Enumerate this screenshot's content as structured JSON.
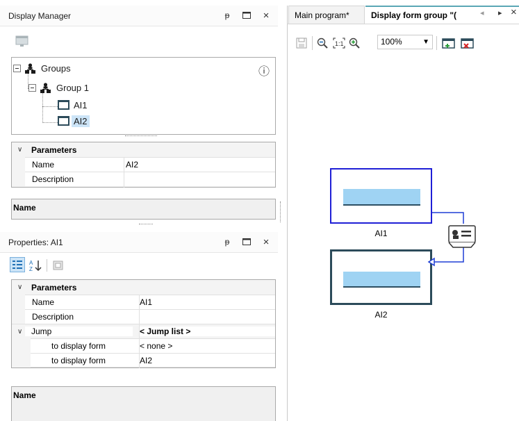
{
  "display_manager": {
    "title": "Display Manager",
    "pin": "ᵽ",
    "maximize": "▭",
    "close": "×",
    "tree": {
      "root": "Groups",
      "group": "Group 1",
      "items": [
        "AI1",
        "AI2"
      ],
      "selected": "AI2",
      "info_icon": "ⓘ"
    },
    "params": {
      "header": "Parameters",
      "rows": [
        {
          "key": "Name",
          "value": "AI2"
        },
        {
          "key": "Description",
          "value": ""
        }
      ]
    },
    "name_section": "Name"
  },
  "properties": {
    "title": "Properties: AI1",
    "pin": "ᵽ",
    "maximize": "▭",
    "close": "×",
    "params": {
      "header": "Parameters",
      "rows": [
        {
          "key": "Name",
          "value": "AI1"
        },
        {
          "key": "Description",
          "value": ""
        }
      ],
      "jump": {
        "key": "Jump",
        "value": "< Jump list >"
      },
      "jump_rows": [
        {
          "key": "to display form",
          "value": "< none >"
        },
        {
          "key": "to display form",
          "value": "AI2"
        }
      ]
    },
    "name_section": "Name"
  },
  "editor": {
    "tabs": [
      {
        "label": "Main program*"
      },
      {
        "label": "Display form group \"("
      }
    ],
    "tab_nav": {
      "left": "◂",
      "right": "▸",
      "close": "×"
    },
    "zoom": "100%",
    "forms": [
      {
        "label": "AI1"
      },
      {
        "label": "AI2"
      }
    ]
  },
  "colors": {
    "selected_bg": "#cce4f7",
    "form_selected_border": "#1f1fd6",
    "form_border": "#2c4b5a",
    "bar_fill": "#9fd3f3",
    "link_blue": "#1f3fd6",
    "active_tab_accent": "#5aa7b5"
  }
}
